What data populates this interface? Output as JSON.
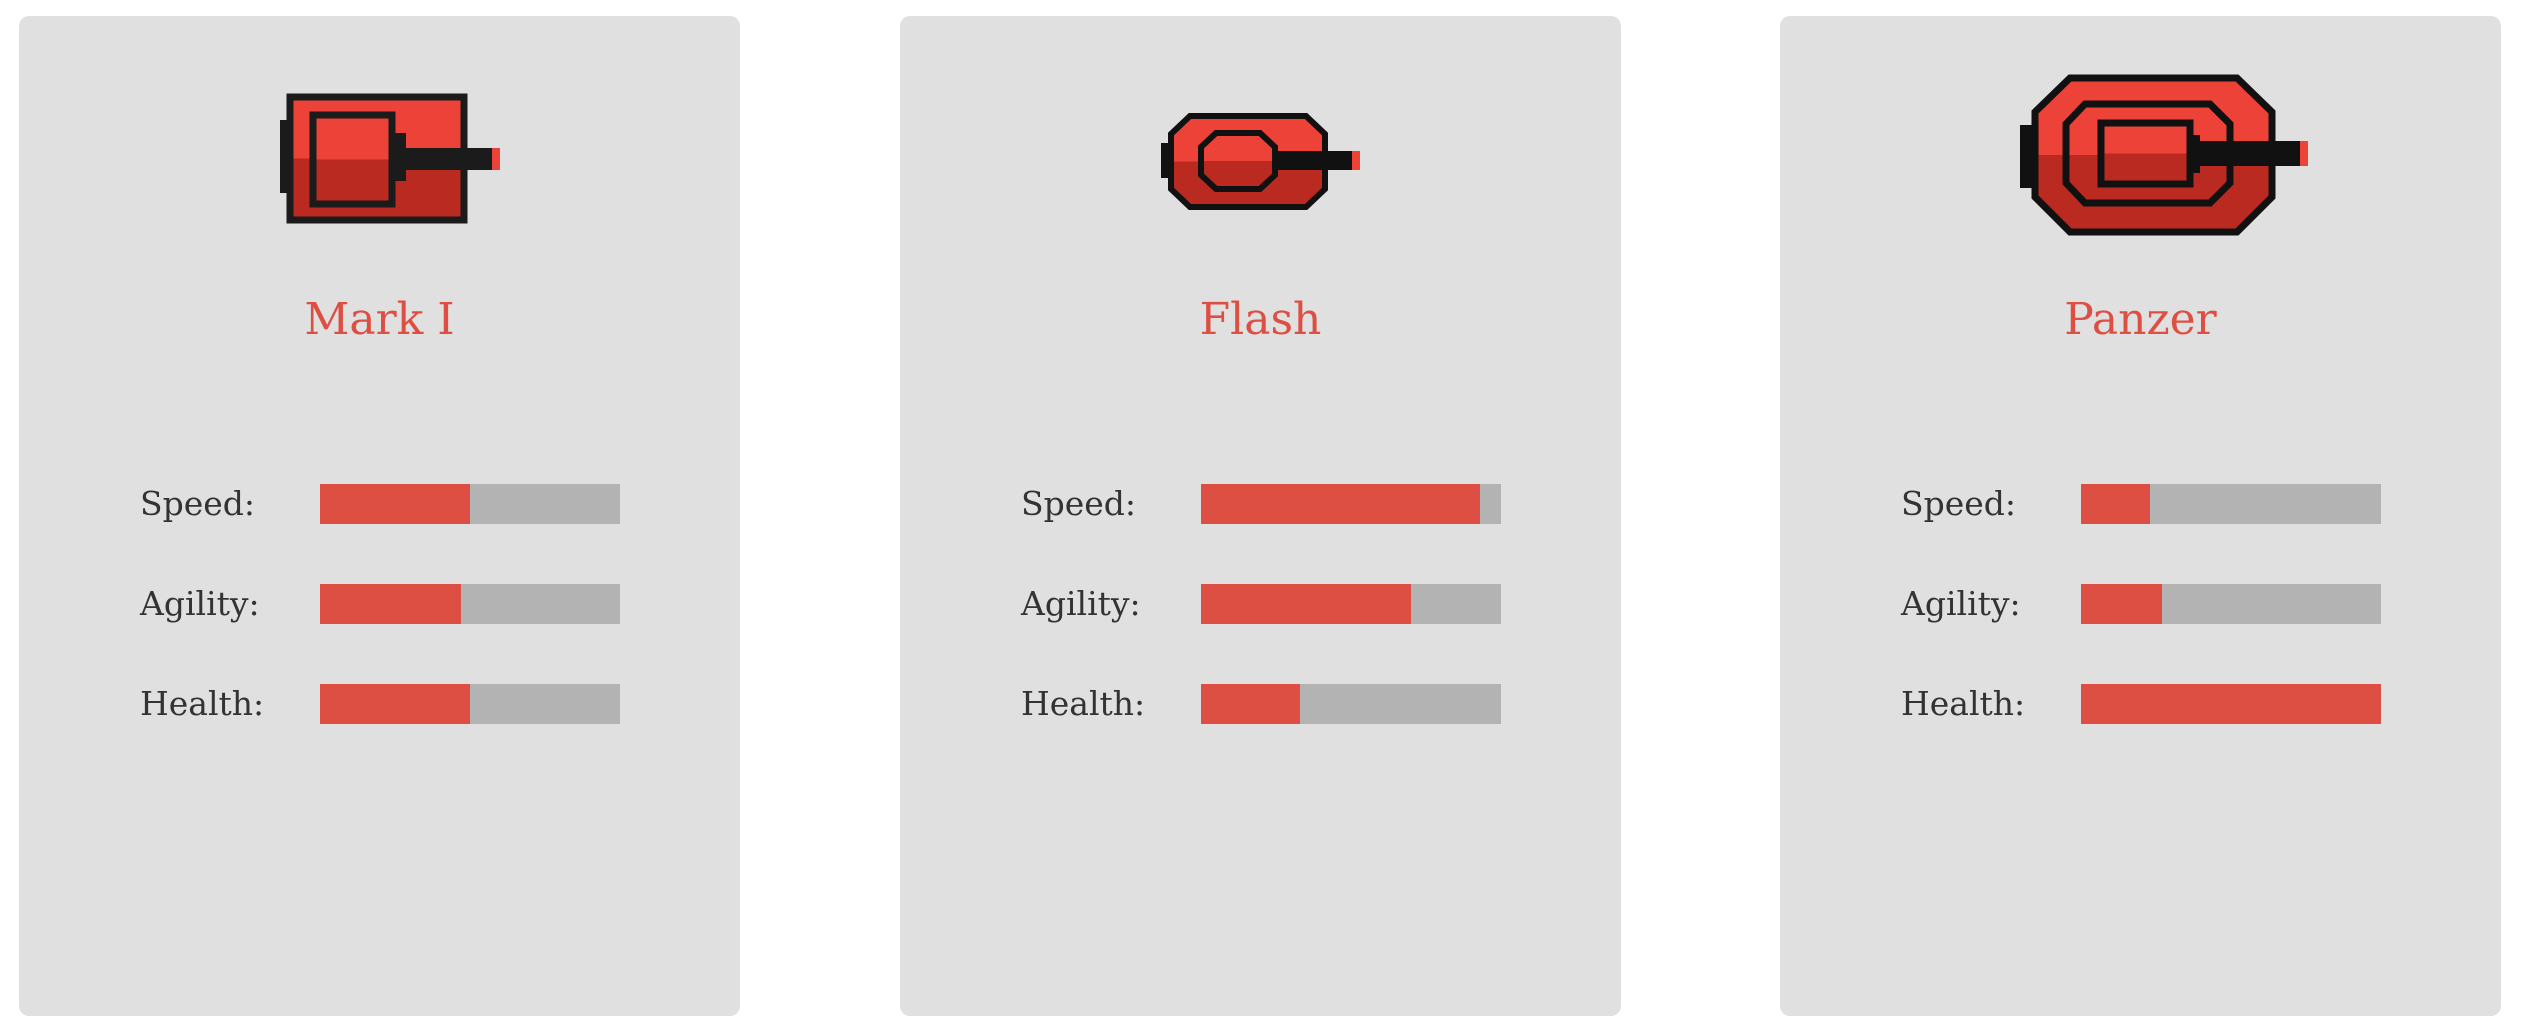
{
  "colors": {
    "accent": "#dd4f42",
    "card": "#e0e0e0",
    "bar_track": "#b3b3b3",
    "tank_light": "#ec4238",
    "tank_dark": "#bb2a20"
  },
  "stat_labels": {
    "speed": "Speed:",
    "agility": "Agility:",
    "health": "Health:"
  },
  "tanks": [
    {
      "name": "Mark I",
      "icon": "tank-mark-i-icon",
      "stats": {
        "speed": 50,
        "agility": 47,
        "health": 50
      }
    },
    {
      "name": "Flash",
      "icon": "tank-flash-icon",
      "stats": {
        "speed": 93,
        "agility": 70,
        "health": 33
      }
    },
    {
      "name": "Panzer",
      "icon": "tank-panzer-icon",
      "stats": {
        "speed": 23,
        "agility": 27,
        "health": 100
      }
    }
  ]
}
